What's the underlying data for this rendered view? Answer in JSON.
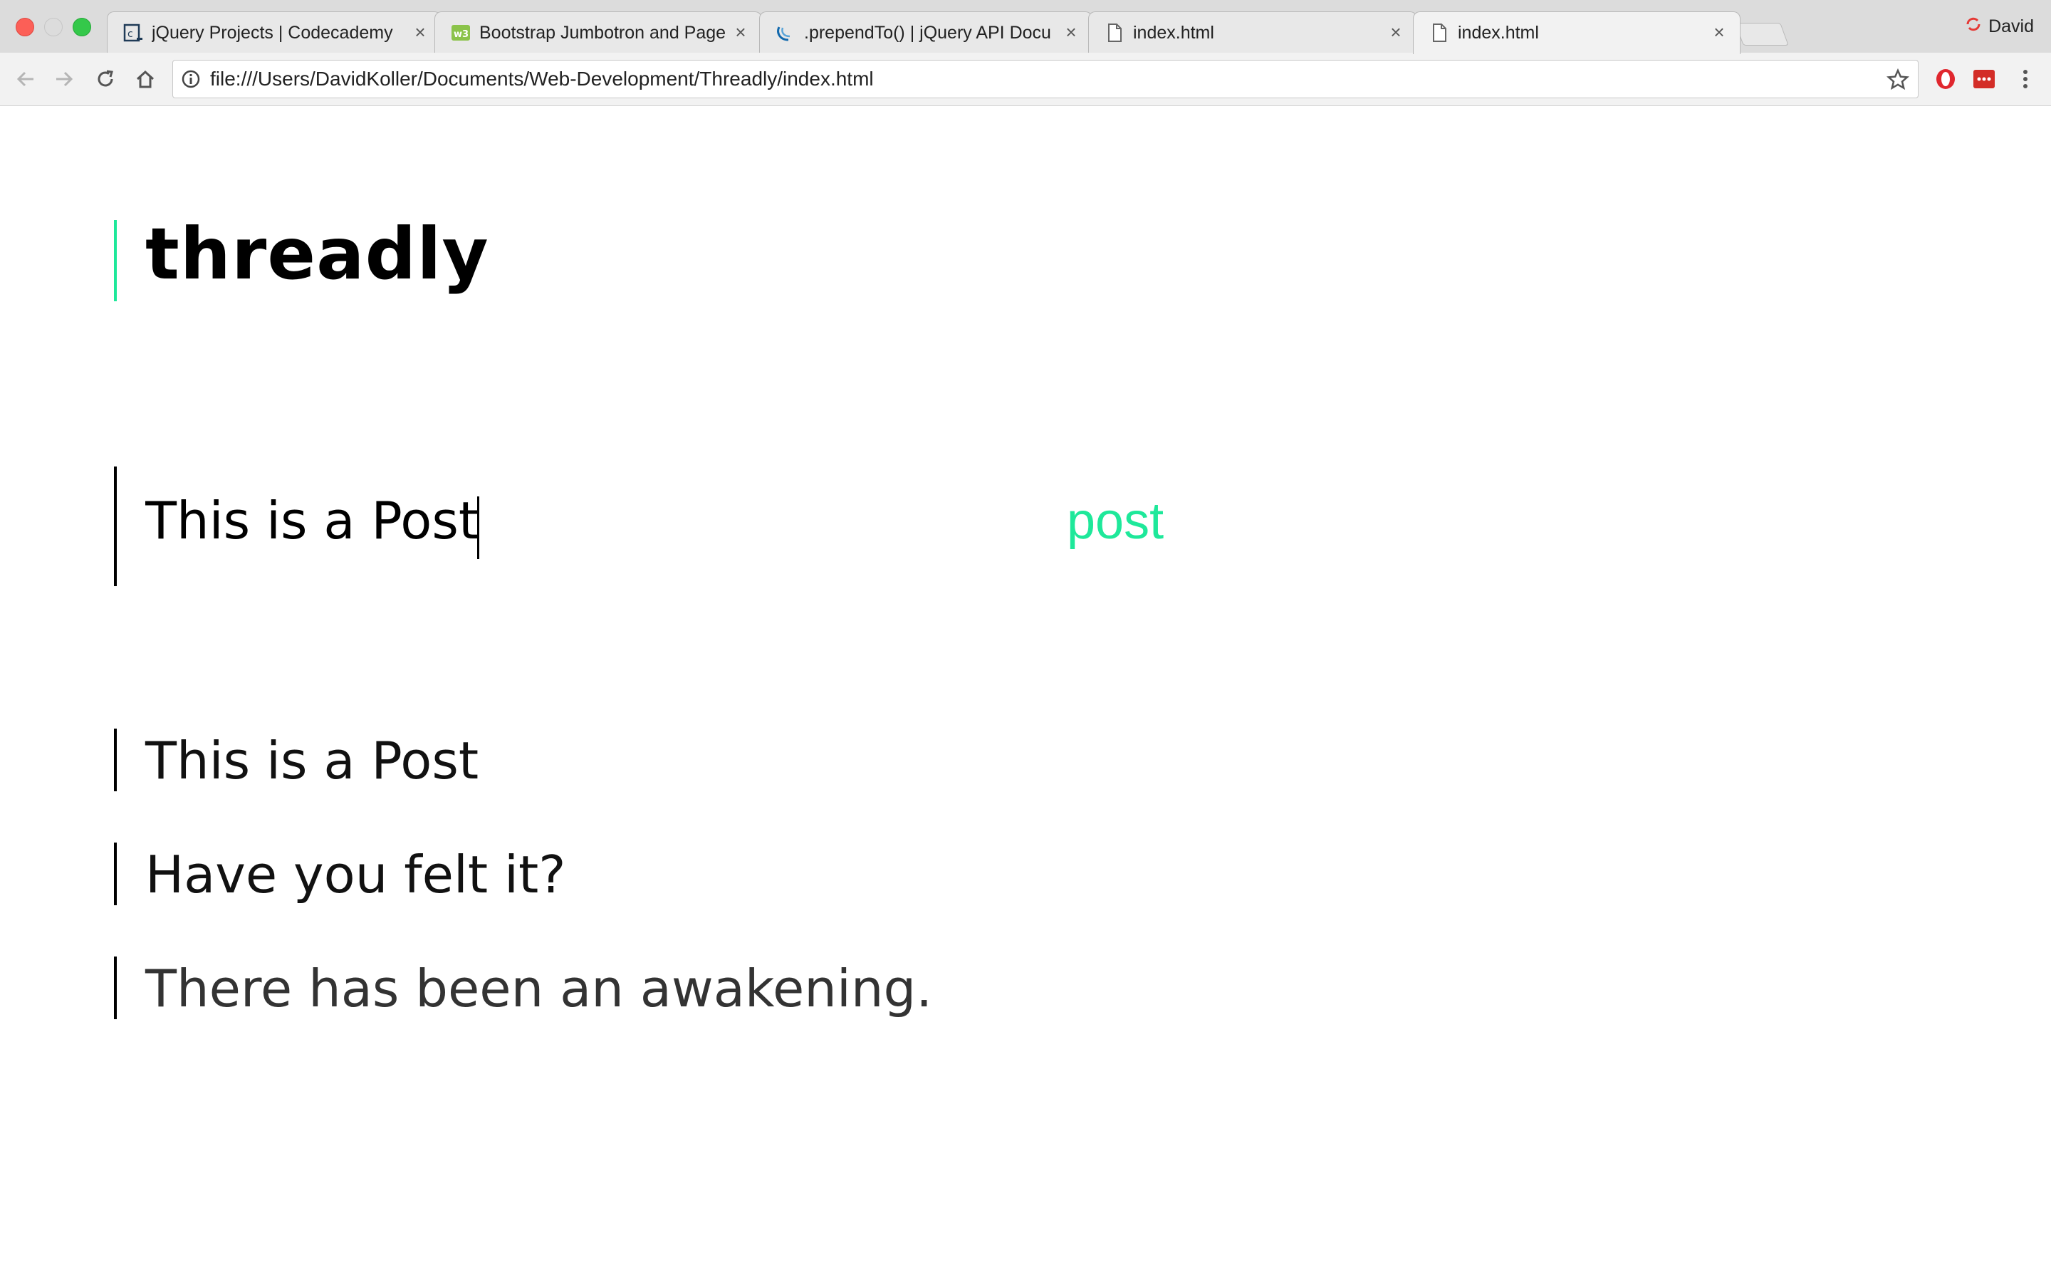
{
  "browser": {
    "tabs": [
      {
        "title": "jQuery Projects | Codecademy",
        "icon": "codecademy-icon"
      },
      {
        "title": "Bootstrap Jumbotron and Page",
        "icon": "w3schools-icon"
      },
      {
        "title": ".prependTo() | jQuery API Docu",
        "icon": "jquery-icon"
      },
      {
        "title": "index.html",
        "icon": "document-icon"
      },
      {
        "title": "index.html",
        "icon": "document-icon",
        "active": true
      }
    ],
    "profile_name": "David",
    "url": "file:///Users/DavidKoller/Documents/Web-Development/Threadly/index.html"
  },
  "app": {
    "title": "threadly",
    "input_value": "This is a Post",
    "post_button": "post",
    "posts": [
      "This is a Post",
      "Have you felt it?",
      "There has been an awakening."
    ]
  },
  "colors": {
    "accent": "#1ee89a",
    "text": "#000000",
    "bar": "#000000"
  }
}
